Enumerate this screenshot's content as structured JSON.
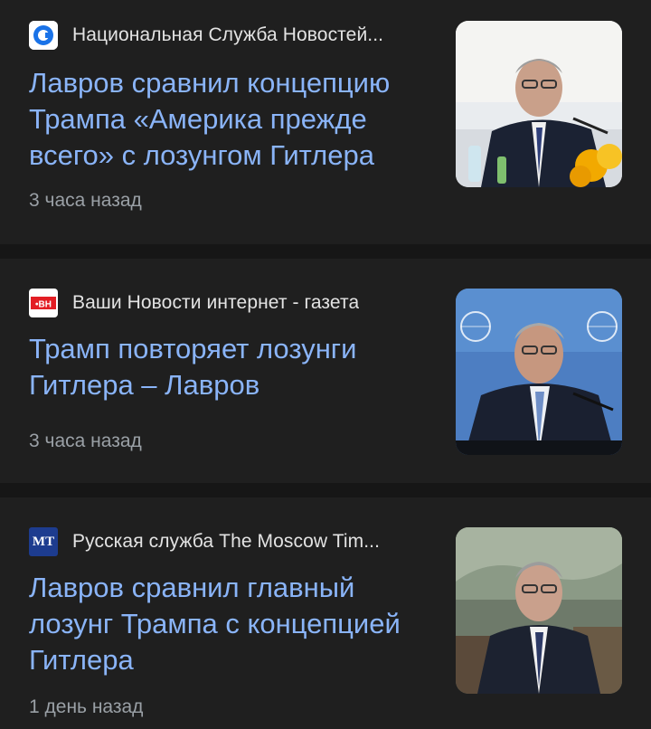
{
  "articles": [
    {
      "source": "Национальная Служба Новостей...",
      "logo": "nsn-logo-icon",
      "headline": "Лавров сравнил концепцию Трампа «Америка прежде всего» с лозунгом Гитлера",
      "time": "3 часа назад",
      "thumbnail": "lavrov-photo-flowers"
    },
    {
      "source": "Ваши Новости интернет - газета",
      "logo": "vn-logo-icon",
      "logo_text": "•ВН",
      "headline": "Трамп повторяет лозунги Гитлера – Лавров",
      "time": "3 часа назад",
      "thumbnail": "lavrov-photo-un"
    },
    {
      "source": "Русская служба The Moscow Tim...",
      "logo": "mt-logo-icon",
      "logo_text": "MT",
      "headline": "Лавров сравнил главный лозунг Трампа с концепцией Гитлера",
      "time": "1 день назад",
      "thumbnail": "lavrov-photo-painting"
    }
  ],
  "colors": {
    "background": "#1f1f1f",
    "separator": "#161616",
    "headline": "#8ab4f8",
    "source": "#e3e3e3",
    "time": "#9aa0a6"
  }
}
